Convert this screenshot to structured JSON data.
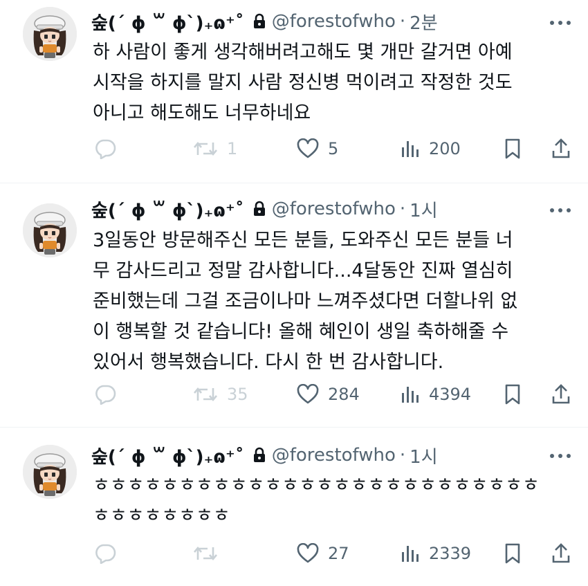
{
  "tweets": [
    {
      "display_name": "숲(´ ɸ ꒳ ɸ`)₊ɷ⁺˚",
      "handle": "@forestofwho",
      "time": "2분",
      "lines": [
        "하 사람이 좋게 생각해버려고해도 몇 개만 갈거면 아예",
        "시작을 하지를 말지 사람 정신병 먹이려고 작정한 것도",
        "아니고 해도해도 너무하네요"
      ],
      "replies": "",
      "retweets": "1",
      "likes": "5",
      "views": "200"
    },
    {
      "display_name": "숲(´ ɸ ꒳ ɸ`)₊ɷ⁺˚",
      "handle": "@forestofwho",
      "time": "1시",
      "lines": [
        "3일동안 방문해주신 모든 분들, 도와주신 모든 분들 너",
        "무 감사드리고 정말 감사합니다...4달동안 진짜 열심히",
        "준비했는데 그걸 조금이나마 느껴주셨다면 더할나위 없",
        "이 행복할 것 같습니다! 올해 혜인이 생일 축하해줄 수",
        "있어서 행복했습니다. 다시 한 번 감사합니다."
      ],
      "replies": "",
      "retweets": "35",
      "likes": "284",
      "views": "4394"
    },
    {
      "display_name": "숲(´ ɸ ꒳ ɸ`)₊ɷ⁺˚",
      "handle": "@forestofwho",
      "time": "1시",
      "lines": [
        "ㅎㅎㅎㅎㅎㅎㅎㅎㅎㅎㅎㅎㅎㅎㅎㅎㅎㅎㅎㅎㅎㅎㅎㅎㅎㅎ",
        "ㅎㅎㅎㅎㅎㅎㅎㅎ"
      ],
      "replies": "",
      "retweets": "",
      "likes": "27",
      "views": "2339"
    }
  ],
  "dot_separator": "·",
  "icons": {
    "lock": "lock-icon",
    "more": "more-icon",
    "reply": "reply-icon",
    "retweet": "retweet-icon",
    "like": "heart-icon",
    "views": "views-icon",
    "bookmark": "bookmark-icon",
    "share": "share-icon"
  },
  "colors": {
    "text_primary": "#0f1419",
    "text_secondary": "#536471",
    "faded": "#c9d1d6",
    "divider": "#eff3f4"
  }
}
